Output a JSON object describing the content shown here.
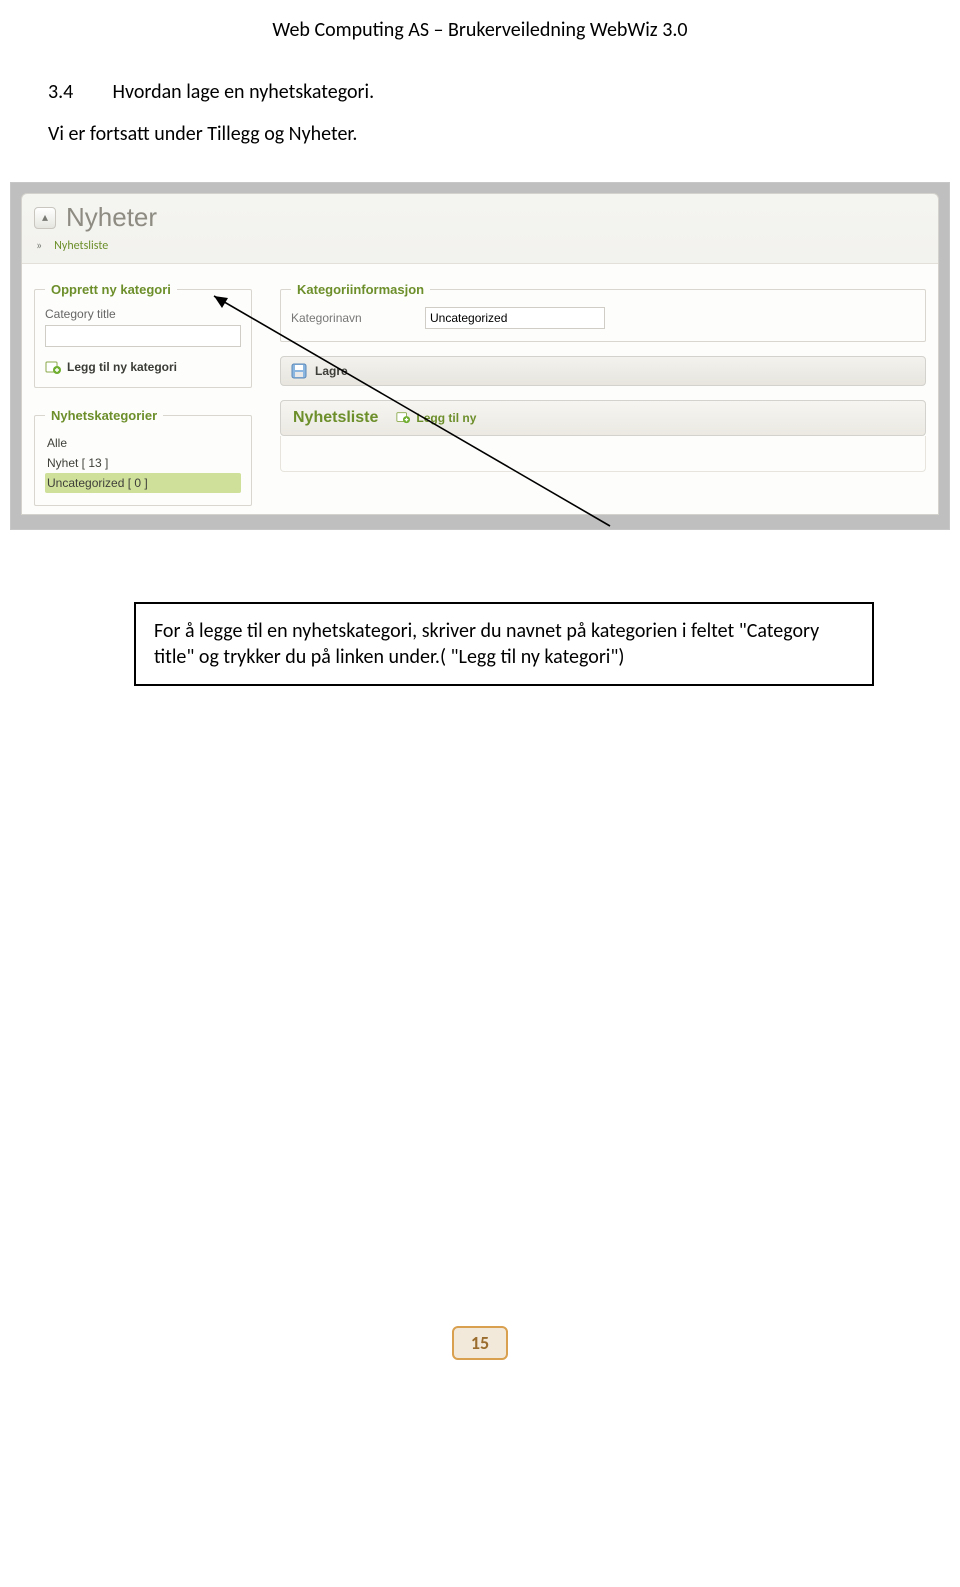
{
  "doc": {
    "header": "Web Computing AS – Brukerveiledning WebWiz 3.0",
    "section_num": "3.4",
    "section_title": "Hvordan lage en nyhetskategori.",
    "intro": "Vi er fortsatt under Tillegg og Nyheter.",
    "callout": "For å legge til en nyhetskategori, skriver du navnet på kategorien i feltet \"Category title\" og trykker du på linken under.( \"Legg til ny kategori\")",
    "page_number": "15"
  },
  "shot": {
    "page_title": "Nyheter",
    "breadcrumb_sep": "»",
    "breadcrumb_item": "Nyhetsliste",
    "left": {
      "create_legend": "Opprett ny kategori",
      "field_label": "Category title",
      "field_value": "",
      "add_link": "Legg til ny kategori",
      "cats_legend": "Nyhetskategorier",
      "rows": {
        "r0": "Alle",
        "r1": "Nyhet [ 13 ]",
        "r2": "Uncategorized [ 0 ]"
      }
    },
    "right": {
      "info_legend": "Kategoriinformasjon",
      "info_label": "Kategorinavn",
      "info_value": "Uncategorized",
      "save_label": "Lagre",
      "list_title": "Nyhetsliste",
      "add_new": "Legg til ny"
    }
  }
}
